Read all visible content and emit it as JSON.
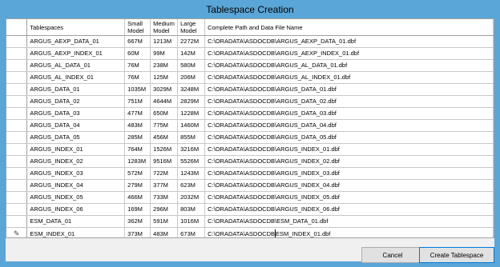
{
  "window": {
    "title": "Tablespace Creation"
  },
  "grid": {
    "headers": {
      "tablespaces": "Tablespaces",
      "small": "Small Model",
      "medium": "Medium Model",
      "large": "Large Model",
      "path": "Complete Path and Data File Name"
    },
    "rows": [
      {
        "name": "ARGUS_AEXP_DATA_01",
        "small": "667M",
        "medium": "1213M",
        "large": "2272M",
        "path": "C:\\ORADATA\\ASDOCDB\\ARGUS_AEXP_DATA_01.dbf"
      },
      {
        "name": "ARGUS_AEXP_INDEX_01",
        "small": "60M",
        "medium": "99M",
        "large": "142M",
        "path": "C:\\ORADATA\\ASDOCDB\\ARGUS_AEXP_INDEX_01.dbf"
      },
      {
        "name": "ARGUS_AL_DATA_01",
        "small": "76M",
        "medium": "238M",
        "large": "580M",
        "path": "C:\\ORADATA\\ASDOCDB\\ARGUS_AL_DATA_01.dbf"
      },
      {
        "name": "ARGUS_AL_INDEX_01",
        "small": "76M",
        "medium": "125M",
        "large": "206M",
        "path": "C:\\ORADATA\\ASDOCDB\\ARGUS_AL_INDEX_01.dbf"
      },
      {
        "name": "ARGUS_DATA_01",
        "small": "1035M",
        "medium": "3029M",
        "large": "3248M",
        "path": "C:\\ORADATA\\ASDOCDB\\ARGUS_DATA_01.dbf"
      },
      {
        "name": "ARGUS_DATA_02",
        "small": "751M",
        "medium": "4644M",
        "large": "2829M",
        "path": "C:\\ORADATA\\ASDOCDB\\ARGUS_DATA_02.dbf"
      },
      {
        "name": "ARGUS_DATA_03",
        "small": "477M",
        "medium": "650M",
        "large": "1228M",
        "path": "C:\\ORADATA\\ASDOCDB\\ARGUS_DATA_03.dbf"
      },
      {
        "name": "ARGUS_DATA_04",
        "small": "483M",
        "medium": "775M",
        "large": "1460M",
        "path": "C:\\ORADATA\\ASDOCDB\\ARGUS_DATA_04.dbf"
      },
      {
        "name": "ARGUS_DATA_05",
        "small": "285M",
        "medium": "456M",
        "large": "855M",
        "path": "C:\\ORADATA\\ASDOCDB\\ARGUS_DATA_05.dbf"
      },
      {
        "name": "ARGUS_INDEX_01",
        "small": "764M",
        "medium": "1526M",
        "large": "3216M",
        "path": "C:\\ORADATA\\ASDOCDB\\ARGUS_INDEX_01.dbf"
      },
      {
        "name": "ARGUS_INDEX_02",
        "small": "1283M",
        "medium": "9516M",
        "large": "5526M",
        "path": "C:\\ORADATA\\ASDOCDB\\ARGUS_INDEX_02.dbf"
      },
      {
        "name": "ARGUS_INDEX_03",
        "small": "572M",
        "medium": "722M",
        "large": "1243M",
        "path": "C:\\ORADATA\\ASDOCDB\\ARGUS_INDEX_03.dbf"
      },
      {
        "name": "ARGUS_INDEX_04",
        "small": "279M",
        "medium": "377M",
        "large": "623M",
        "path": "C:\\ORADATA\\ASDOCDB\\ARGUS_INDEX_04.dbf"
      },
      {
        "name": "ARGUS_INDEX_05",
        "small": "466M",
        "medium": "733M",
        "large": "2032M",
        "path": "C:\\ORADATA\\ASDOCDB\\ARGUS_INDEX_05.dbf"
      },
      {
        "name": "ARGUS_INDEX_06",
        "small": "169M",
        "medium": "296M",
        "large": "803M",
        "path": "C:\\ORADATA\\ASDOCDB\\ARGUS_INDEX_06.dbf"
      },
      {
        "name": "ESM_DATA_01",
        "small": "362M",
        "medium": "591M",
        "large": "1016M",
        "path": "C:\\ORADATA\\ASDOCDB\\ESM_DATA_01.dbf"
      }
    ],
    "edit_row": {
      "name": "ESM_INDEX_01",
      "small": "373M",
      "medium": "483M",
      "large": "673M",
      "path_before_caret": "C:\\ORADATA\\ASDOCDB",
      "path_after_caret": "ESM_INDEX_01.dbf",
      "row_icon": "pencil-icon"
    }
  },
  "buttons": {
    "cancel": "Cancel",
    "create": "Create Tablespace"
  }
}
